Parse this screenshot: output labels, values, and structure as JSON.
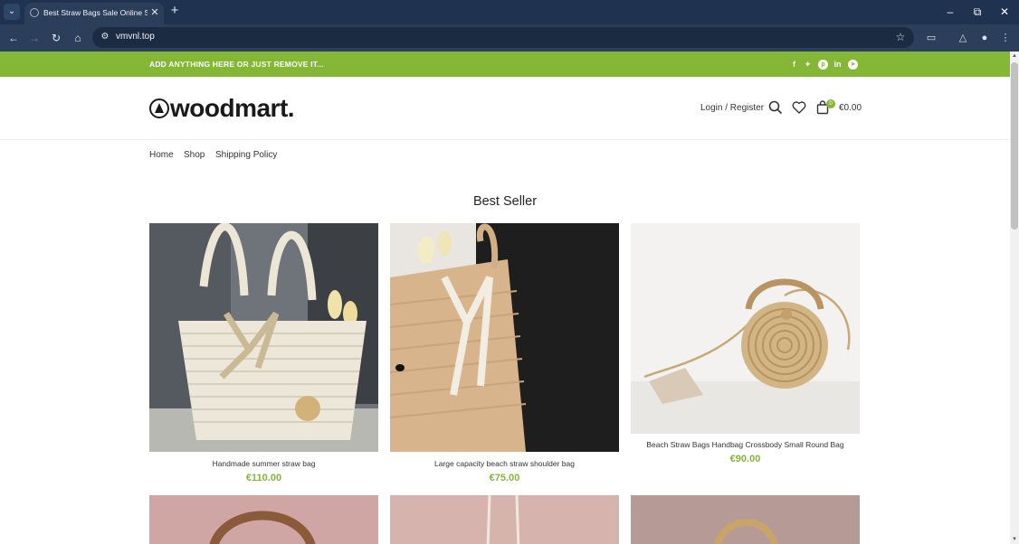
{
  "browser": {
    "tab_title": "Best Straw Bags Sale Online Sh",
    "url": "vmvnl.top"
  },
  "topbar": {
    "text": "ADD ANYTHING HERE OR JUST REMOVE IT...",
    "social": [
      "facebook-icon",
      "twitter-icon",
      "pinterest-icon",
      "linkedin-icon",
      "telegram-icon"
    ]
  },
  "header": {
    "logo": "woodmart.",
    "login": "Login / Register",
    "cart_count": "0",
    "cart_total": "€0.00"
  },
  "nav": {
    "items": [
      {
        "label": "Home"
      },
      {
        "label": "Shop"
      },
      {
        "label": "Shipping Policy"
      }
    ]
  },
  "section": {
    "title": "Best Seller"
  },
  "products": [
    {
      "name": "Handmade summer straw bag",
      "price": "€110.00"
    },
    {
      "name": "Large capacity beach straw shoulder bag",
      "price": "€75.00"
    },
    {
      "name": "Beach Straw Bags Handbag Crossbody Small Round Bag",
      "price": "€90.00"
    }
  ],
  "colors": {
    "accent": "#83b735",
    "chrome_dark": "#1f3350",
    "chrome_mid": "#2b3e5a"
  }
}
